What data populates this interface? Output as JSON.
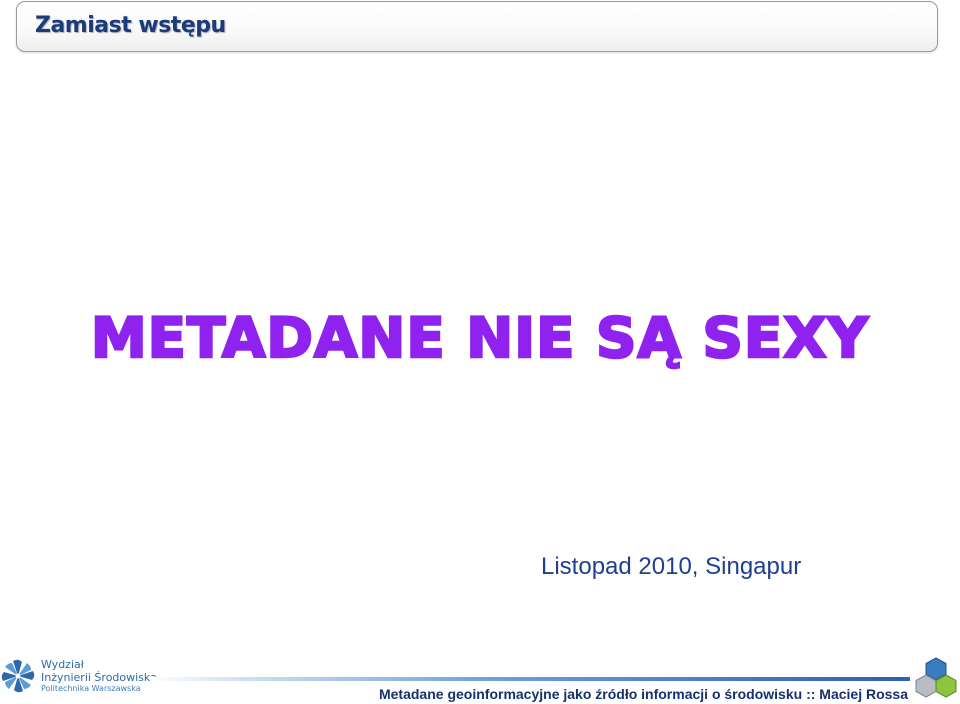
{
  "header": {
    "title": "Zamiast wstępu"
  },
  "main": {
    "headline": "METADANE NIE SĄ SEXY",
    "subtitle": "Listopad 2010, Singapur"
  },
  "footer": {
    "logo": {
      "line1": "Wydział",
      "line2": "Inżynierii Środowiska",
      "line3": "Politechnika Warszawska",
      "icon": "pinwheel-logo"
    },
    "caption": "Metadane geoinformacyjne jako źródło informacji o środowisku :: Maciej Rossa",
    "decor_icon": "hexagon-cluster"
  },
  "colors": {
    "title": "#1d3a7a",
    "headline": "#8f22ee",
    "subtitle": "#1f3f8f",
    "footer_text": "#17306e",
    "logo_blue": "#2e6aa8",
    "hex_blue": "#3a7cc0",
    "hex_green": "#8cc63f",
    "hex_gray": "#b8bcc4"
  }
}
